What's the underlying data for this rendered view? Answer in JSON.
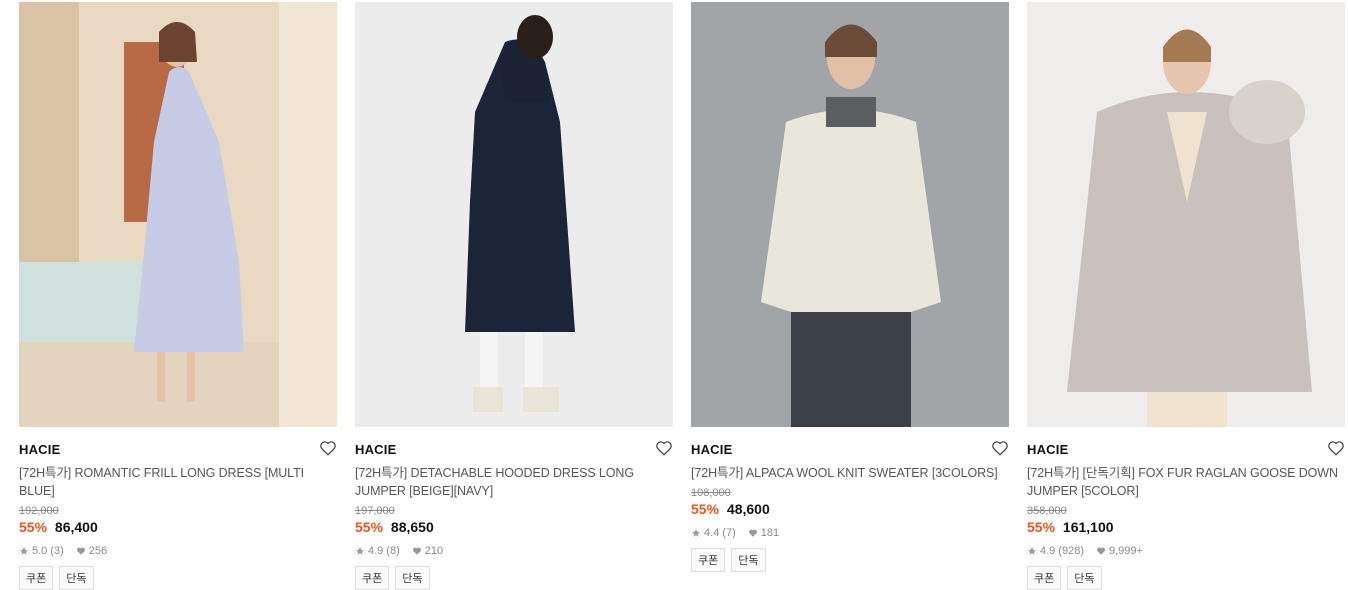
{
  "products": [
    {
      "brand": "HACIE",
      "title": "[72H특가] ROMANTIC FRILL LONG DRESS [MULTI BLUE]",
      "original_price": "192,000",
      "discount": "55%",
      "price": "86,400",
      "rating": "5.0",
      "reviews": "(3)",
      "likes": "256",
      "tags": [
        "쿠폰",
        "단독"
      ]
    },
    {
      "brand": "HACIE",
      "title": "[72H특가] DETACHABLE HOODED DRESS LONG JUMPER [BEIGE][NAVY]",
      "original_price": "197,000",
      "discount": "55%",
      "price": "88,650",
      "rating": "4.9",
      "reviews": "(8)",
      "likes": "210",
      "tags": [
        "쿠폰",
        "단독"
      ]
    },
    {
      "brand": "HACIE",
      "title": "[72H특가] ALPACA WOOL KNIT SWEATER [3COLORS]",
      "original_price": "108,000",
      "discount": "55%",
      "price": "48,600",
      "rating": "4.4",
      "reviews": "(7)",
      "likes": "181",
      "tags": [
        "쿠폰",
        "단독"
      ]
    },
    {
      "brand": "HACIE",
      "title": "[72H특가] [단독기획] FOX FUR RAGLAN GOOSE DOWN JUMPER [5COLOR]",
      "original_price": "358,000",
      "discount": "55%",
      "price": "161,100",
      "rating": "4.9",
      "reviews": "(928)",
      "likes": "9,999+",
      "tags": [
        "쿠폰",
        "단독"
      ]
    }
  ],
  "colors": {
    "discount": "#f0531c",
    "text": "#222222",
    "muted": "#888888"
  }
}
